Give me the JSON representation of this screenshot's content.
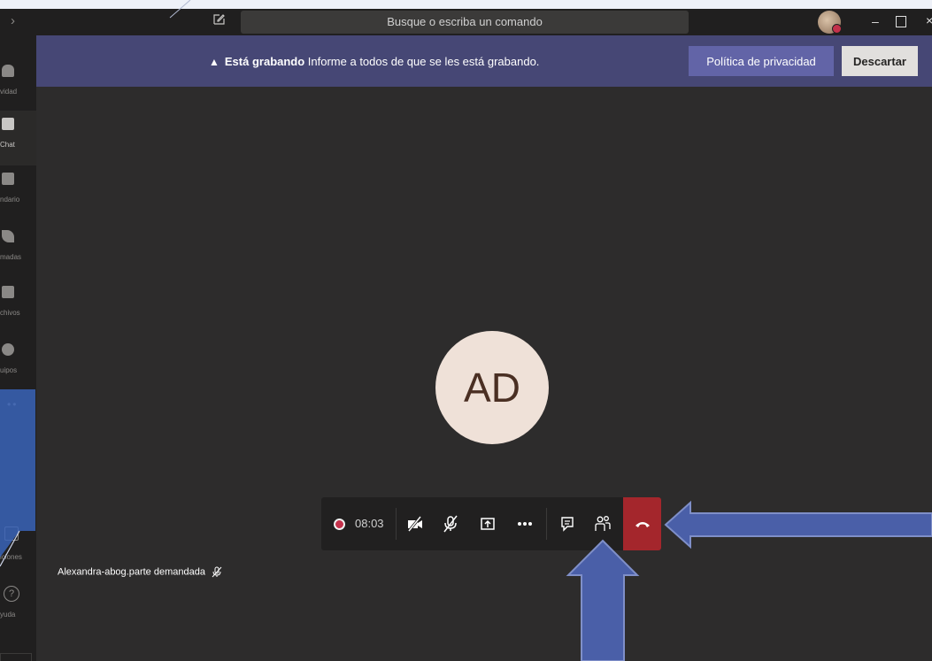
{
  "titlebar": {
    "search_placeholder": "Busque o escriba un comando",
    "back_glyph": "›",
    "minimize_glyph": "–",
    "close_glyph": "×"
  },
  "sidebar": {
    "items": [
      {
        "label": "vidad",
        "icon": "bell-icon"
      },
      {
        "label": "Chat",
        "icon": "chat-icon",
        "active": true
      },
      {
        "label": "ndario",
        "icon": "calendar-icon"
      },
      {
        "label": "madas",
        "icon": "phone-icon"
      },
      {
        "label": "chivos",
        "icon": "file-icon"
      },
      {
        "label": "uipos",
        "icon": "teams-icon"
      }
    ],
    "more": "••",
    "apps_label": "iciones",
    "help_label": "yuda",
    "help_glyph": "?"
  },
  "banner": {
    "bold": "Está grabando",
    "text": " Informe a todos de que se les está grabando.",
    "privacy_button": "Política de privacidad",
    "dismiss_button": "Descartar",
    "color": "#464775"
  },
  "call": {
    "avatar_initials": "AD",
    "timer": "08:03",
    "participant_name": "Alexandra-abog.parte demandada",
    "controls": [
      "camera-off-icon",
      "mic-off-icon",
      "share-screen-icon",
      "more-options-icon",
      "chat-icon",
      "participants-icon",
      "hang-up-icon"
    ],
    "hangup_color": "#a4262c"
  },
  "annotations": {
    "arrow_color": "#4a5fa8"
  }
}
